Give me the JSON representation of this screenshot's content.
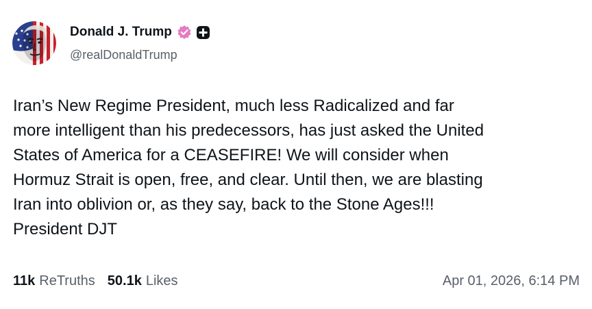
{
  "author": {
    "display_name": "Donald J. Trump",
    "handle": "@realDonaldTrump",
    "avatar_icon": "avatar-flag-portrait",
    "verified_icon": "verified-badge-icon",
    "plus_icon": "plus-badge-icon",
    "verified_color": "#e57cc2"
  },
  "post": {
    "text": "Iran’s New Regime President, much less Radicalized and far\nmore intelligent than his predecessors, has just asked the United\nStates of America for a CEASEFIRE! We will consider when\nHormuz Strait is open, free, and clear. Until then, we are blasting\nIran into oblivion or, as they say, back to the Stone Ages!!!\nPresident DJT"
  },
  "stats": {
    "retruths_count": "11k",
    "retruths_label": "ReTruths",
    "likes_count": "50.1k",
    "likes_label": "Likes"
  },
  "timestamp": "Apr 01, 2026, 6:14 PM"
}
